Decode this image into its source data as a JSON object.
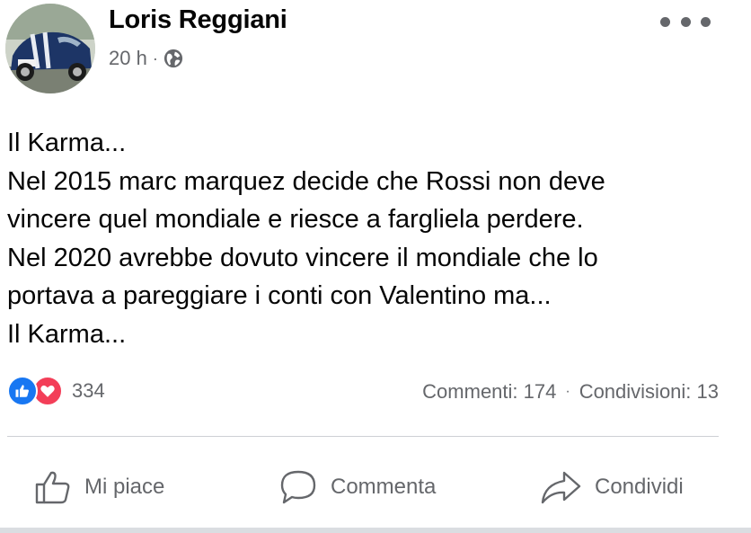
{
  "post": {
    "author": "Loris Reggiani",
    "timestamp": "20 h",
    "separator": "·",
    "privacy_icon": "globe-icon",
    "more_icon": "more-options-icon",
    "body_lines": [
      "Il Karma...",
      "Nel 2015 marc marquez decide che Rossi non deve",
      "vincere quel mondiale e riesce a fargliela perdere.",
      "Nel 2020 avrebbe dovuto vincere il mondiale che lo",
      "portava a pareggiare i conti con Valentino ma...",
      "Il Karma..."
    ]
  },
  "reactions": {
    "icons": [
      "like-icon",
      "love-icon"
    ],
    "count": "334"
  },
  "stats": {
    "comments": "Commenti: 174",
    "separator": "·",
    "shares": "Condivisioni: 13"
  },
  "actions": {
    "like": "Mi piace",
    "comment": "Commenta",
    "share": "Condividi"
  },
  "colors": {
    "secondary_text": "#65676b",
    "like_blue": "#1877f2",
    "love_red": "#f33e58",
    "divider": "#ced0d4"
  }
}
